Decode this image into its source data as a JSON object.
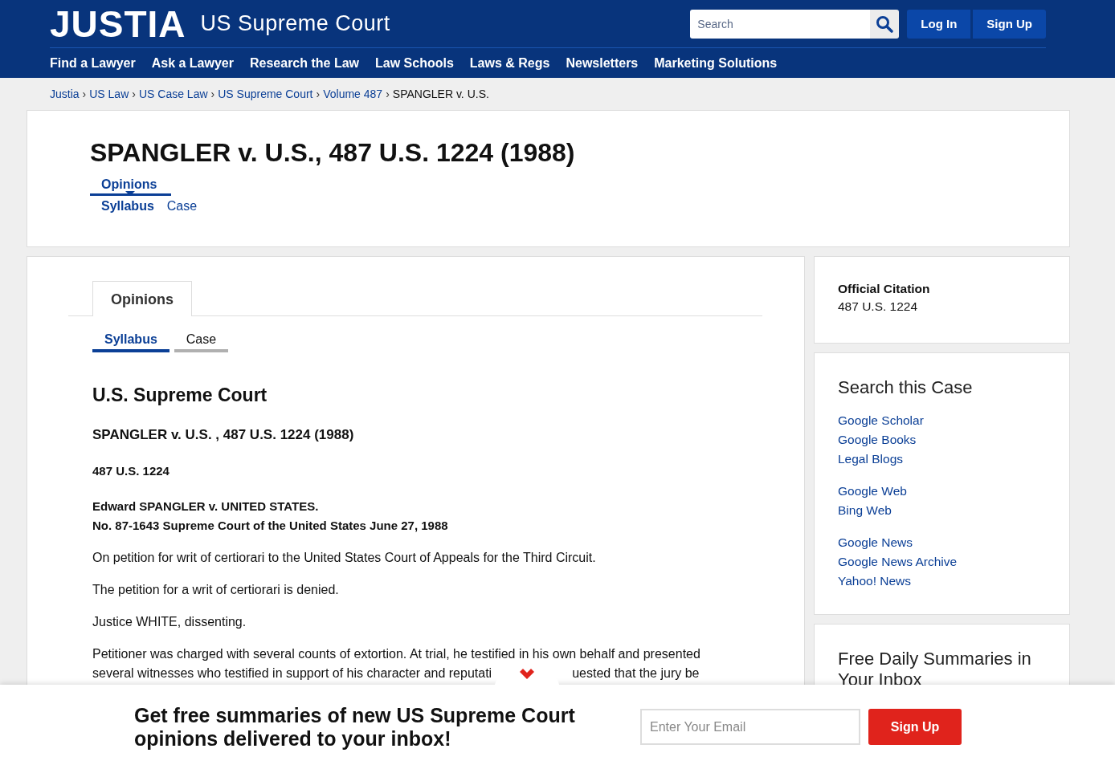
{
  "header": {
    "logo": "JUSTIA",
    "section": "US Supreme Court",
    "search": {
      "placeholder": "Search"
    },
    "buttons": [
      "Log In",
      "Sign Up"
    ],
    "nav": [
      "Find a Lawyer",
      "Ask a Lawyer",
      "Research the Law",
      "Law Schools",
      "Laws & Regs",
      "Newsletters",
      "Marketing Solutions"
    ]
  },
  "breadcrumb": {
    "links": [
      "Justia",
      "US Law",
      "US Case Law",
      "US Supreme Court",
      "Volume 487"
    ],
    "separator": "›",
    "current": "SPANGLER v. U.S."
  },
  "title_card": {
    "title": "SPANGLER v. U.S., 487 U.S. 1224 (1988)",
    "section": "Opinions",
    "links": [
      {
        "label": "Syllabus",
        "selected": true
      },
      {
        "label": "Case",
        "selected": false
      }
    ]
  },
  "main": {
    "tab": "Opinions",
    "subtabs": [
      {
        "label": "Syllabus",
        "selected": true
      },
      {
        "label": "Case",
        "selected": false
      }
    ],
    "court": "U.S. Supreme Court",
    "case_title": "SPANGLER v. U.S. , 487 U.S. 1224 (1988)",
    "citation": "487 U.S. 1224",
    "parties": [
      "Edward SPANGLER v. UNITED STATES.",
      "No. 87-1643 Supreme Court of the United States June 27, 1988"
    ],
    "paragraphs": [
      "On petition for writ of certiorari to the United States Court of Appeals for the Third Circuit.",
      "The petition for a writ of certiorari is denied.",
      "Justice WHITE, dissenting."
    ],
    "last_paragraph": {
      "lines": [
        "Petitioner was charged with several counts of extortion. At trial, he testified in his own behalf and presented",
        "several witnesses who testified in support of his character and reputati"
      ],
      "continued": "uested that the jury be"
    }
  },
  "sidebar": {
    "citation": {
      "heading": "Official Citation",
      "value": "487 U.S. 1224"
    },
    "search_case": {
      "heading": "Search this Case",
      "groups": [
        [
          "Google Scholar",
          "Google Books",
          "Legal Blogs"
        ],
        [
          "Google Web",
          "Bing Web"
        ],
        [
          "Google News",
          "Google News Archive",
          "Yahoo! News"
        ]
      ]
    },
    "summaries": {
      "heading": "Free Daily Summaries in Your Inbox"
    }
  },
  "newsletter_bar": {
    "text": "Get free summaries of new US Supreme Court opinions delivered to your inbox!",
    "email": {
      "placeholder": "Enter Your Email"
    },
    "button": "Sign Up"
  }
}
